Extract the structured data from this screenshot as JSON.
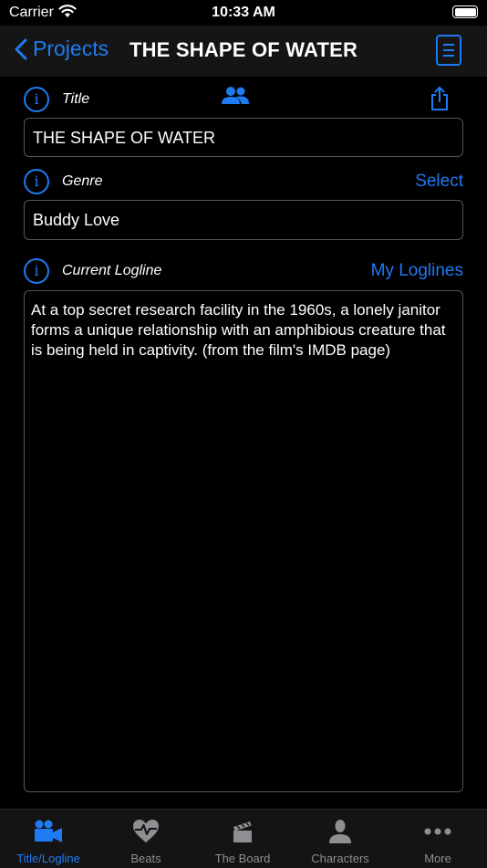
{
  "status_bar": {
    "carrier": "Carrier",
    "time": "10:33 AM"
  },
  "nav": {
    "back_label": "Projects",
    "title": "THE SHAPE OF WATER"
  },
  "title_field": {
    "label": "Title",
    "value": "THE SHAPE OF WATER"
  },
  "genre_field": {
    "label": "Genre",
    "action": "Select",
    "value": "Buddy Love"
  },
  "logline_field": {
    "label": "Current Logline",
    "action": "My Loglines",
    "value": "At a top secret research facility in the 1960s, a lonely janitor forms a unique relationship with an amphibious creature that is being held in captivity. (from the film's IMDB page)"
  },
  "tabs": [
    {
      "label": "Title/Logline",
      "icon": "video-camera-icon",
      "active": true
    },
    {
      "label": "Beats",
      "icon": "heart-pulse-icon",
      "active": false
    },
    {
      "label": "The Board",
      "icon": "clapperboard-icon",
      "active": false
    },
    {
      "label": "Characters",
      "icon": "person-icon",
      "active": false
    },
    {
      "label": "More",
      "icon": "more-dots-icon",
      "active": false
    }
  ],
  "colors": {
    "accent": "#1e7bf3",
    "background": "#000000",
    "bar": "#151515",
    "inactive": "#8e8e93"
  }
}
